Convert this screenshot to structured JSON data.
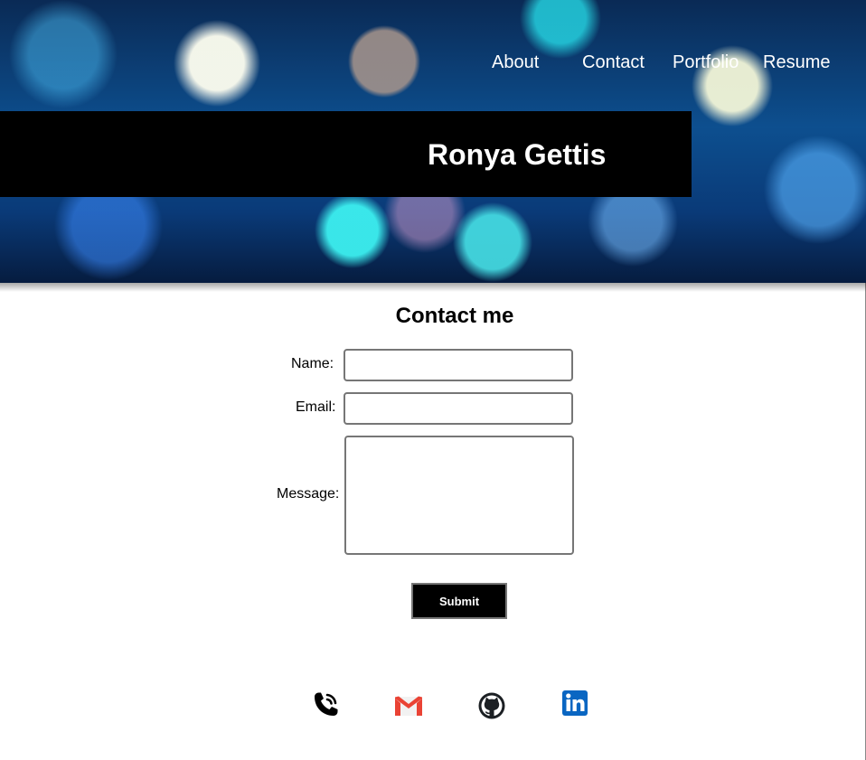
{
  "header": {
    "nav": [
      {
        "label": "About"
      },
      {
        "label": "Contact"
      },
      {
        "label": "Portfolio"
      },
      {
        "label": "Resume"
      }
    ],
    "name": "Ronya Gettis"
  },
  "contact": {
    "heading": "Contact me",
    "name_label": "Name:",
    "email_label": "Email:",
    "message_label": "Message:",
    "name_value": "",
    "email_value": "",
    "message_value": "",
    "submit_label": "Submit"
  },
  "social": [
    {
      "icon": "phone-icon"
    },
    {
      "icon": "gmail-icon"
    },
    {
      "icon": "github-icon"
    },
    {
      "icon": "linkedin-icon"
    }
  ],
  "colors": {
    "title_bar": "#000000",
    "nav_text": "#ffffff",
    "submit_bg": "#000000",
    "gmail_red": "#EA4335",
    "linkedin_blue": "#0A66C2"
  }
}
